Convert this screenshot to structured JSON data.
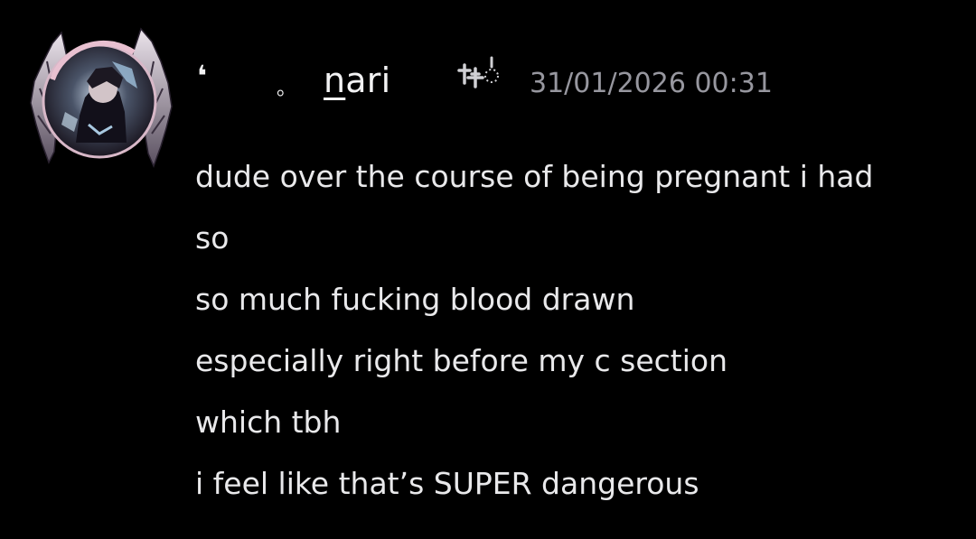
{
  "message": {
    "author": {
      "decoration_left": "❛",
      "decoration_dot": "。",
      "name_first": "n",
      "name_rest": "ari",
      "role_icon": "role-badge-icon",
      "avatar_icon": "winged-avatar-icon"
    },
    "timestamp": "31/01/2026 00:31",
    "lines": [
      "dude over the course of being pregnant i had",
      "so",
      "so much fucking blood drawn",
      "especially right before my c section",
      "which tbh",
      "i feel like that’s SUPER dangerous"
    ]
  },
  "colors": {
    "background": "#000000",
    "text": "#e9e9eb",
    "timestamp": "#97979f",
    "avatar_accent": "#d8b8c8"
  }
}
